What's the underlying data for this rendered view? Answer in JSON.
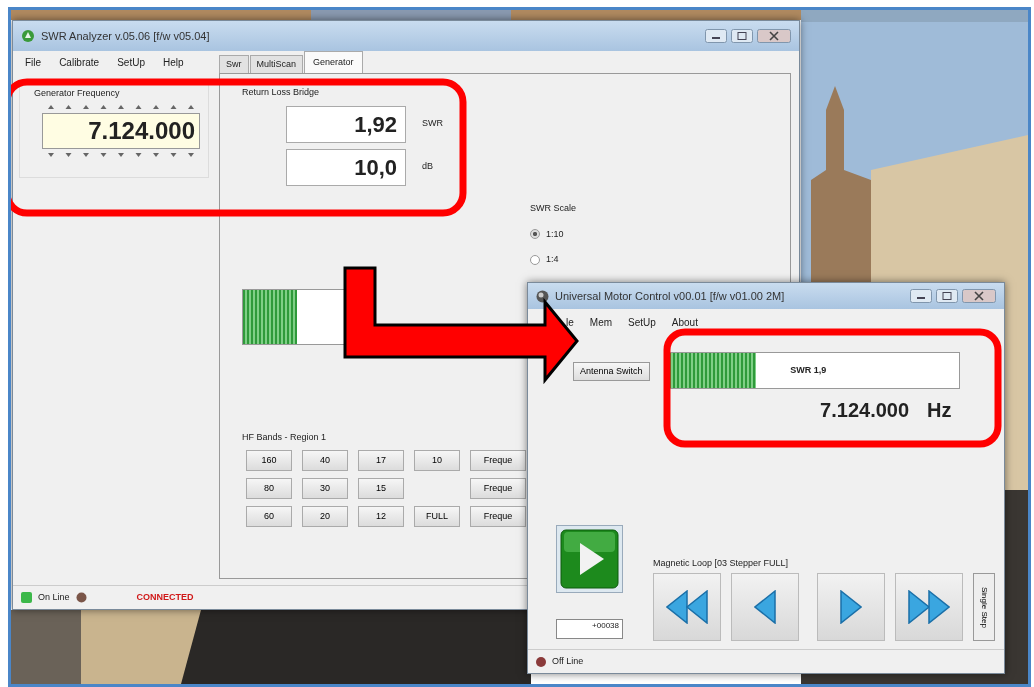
{
  "analyzer": {
    "title": "SWR Analyzer v.05.06 [f/w v05.04]",
    "menu": [
      "File",
      "Calibrate",
      "SetUp",
      "Help"
    ],
    "generator_frequency": {
      "label": "Generator Frequency",
      "value": "7.124.000"
    },
    "tabs": [
      {
        "label": "Swr",
        "selected": false
      },
      {
        "label": "MultiScan",
        "selected": false
      },
      {
        "label": "Generator",
        "selected": true
      }
    ],
    "return_loss_bridge": {
      "label": "Return Loss Bridge",
      "readings": [
        {
          "value": "1,92",
          "unit": "SWR"
        },
        {
          "value": "10,0",
          "unit": "dB"
        }
      ]
    },
    "swr_scale": {
      "label": "SWR Scale",
      "options": [
        {
          "label": "1:10",
          "selected": true
        },
        {
          "label": "1:4",
          "selected": false
        }
      ]
    },
    "meter": {
      "level": 0.52
    },
    "hf_bands": {
      "label": "HF Bands - Region 1",
      "rows": [
        {
          "bands": [
            "160",
            "40",
            "17",
            "10"
          ],
          "frequency_button": "Freque"
        },
        {
          "bands": [
            "80",
            "30",
            "15"
          ],
          "frequency_button": "Freque"
        },
        {
          "bands": [
            "60",
            "20",
            "12",
            "FULL"
          ],
          "frequency_button": "Freque"
        }
      ]
    },
    "status": {
      "online": "On Line",
      "connection": "CONNECTED"
    }
  },
  "motor_control": {
    "title": "Universal Motor Control v00.01 [f/w v01.00 2M]",
    "menu": [
      "le",
      "Mem",
      "SetUp",
      "About"
    ],
    "antenna_switch": "Antenna Switch",
    "meter": {
      "level": 0.3,
      "reading": "SWR 1,9"
    },
    "frequency": "7.124.000",
    "unit": "Hz",
    "counter": "+00038",
    "loop_label": "Magnetic Loop [03 Stepper FULL]",
    "step_buttons": [
      {
        "kind": "fast-back"
      },
      {
        "kind": "back"
      },
      {
        "kind": "forward"
      },
      {
        "kind": "fast-forward"
      }
    ],
    "single_step": "Single Step",
    "status": "Off Line"
  }
}
